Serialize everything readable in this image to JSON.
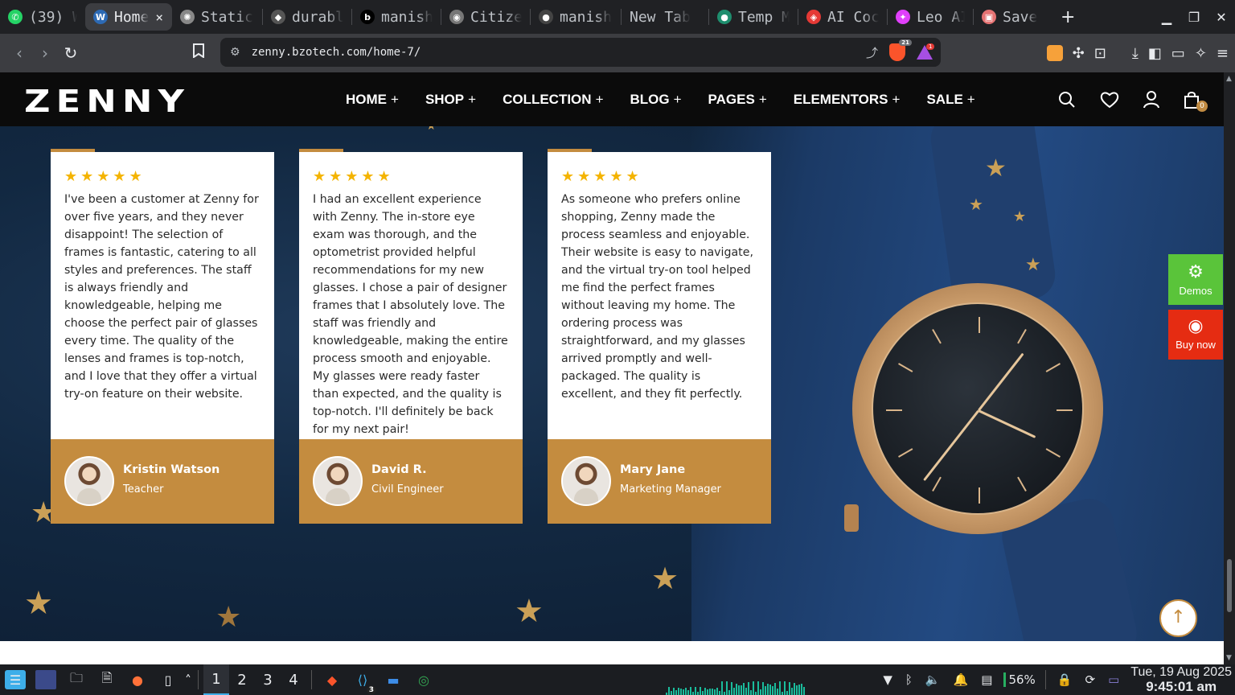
{
  "browser": {
    "tabs": [
      {
        "title": "(39) W",
        "color": "#25d366",
        "glyph": "✆"
      },
      {
        "title": "Home",
        "color": "#2d6ab4",
        "glyph": "W",
        "active": true,
        "close": "×"
      },
      {
        "title": "Static",
        "color": "#888888",
        "glyph": "✺"
      },
      {
        "title": "durabl",
        "color": "#555555",
        "glyph": "◆"
      },
      {
        "title": "manish",
        "color": "#000000",
        "glyph": "b"
      },
      {
        "title": "Citize",
        "color": "#777777",
        "glyph": "◉"
      },
      {
        "title": "manish",
        "color": "#444444",
        "glyph": "●"
      },
      {
        "title": "New Tab",
        "color": "",
        "glyph": ""
      },
      {
        "title": "Temp M",
        "color": "#1e8e6e",
        "glyph": "●"
      },
      {
        "title": "AI Coc",
        "color": "#e53935",
        "glyph": "◈"
      },
      {
        "title": "Leo AI",
        "color": "#e040fb",
        "glyph": "✦"
      },
      {
        "title": "Save",
        "color": "#e57373",
        "glyph": "▣"
      }
    ],
    "new_tab_label": "+",
    "url": "zenny.bzotech.com/home-7/",
    "brave_badge": "21",
    "rewards_badge": "1"
  },
  "site": {
    "logo": "ZENNY",
    "nav": [
      {
        "label": "HOME",
        "plus": "+"
      },
      {
        "label": "SHOP",
        "plus": "+"
      },
      {
        "label": "COLLECTION",
        "plus": "+"
      },
      {
        "label": "BLOG",
        "plus": "+"
      },
      {
        "label": "PAGES",
        "plus": "+"
      },
      {
        "label": "ELEMENTORS",
        "plus": "+"
      },
      {
        "label": "SALE",
        "plus": "+"
      }
    ],
    "cart_count": "0",
    "accent": "#c48c3f"
  },
  "testimonials": [
    {
      "stars": "★★★★★",
      "quote": "I've been a customer at Zenny for over five years, and they never disappoint! The selection of frames is fantastic, catering to all styles and preferences. The staff is always friendly and knowledgeable, helping me choose the perfect pair of glasses every time. The quality of the lenses and frames is top-notch, and I love that they offer a virtual try-on feature on their website.",
      "name": "Kristin Watson",
      "role": "Teacher"
    },
    {
      "stars": "★★★★★",
      "quote": "I had an excellent experience with Zenny. The in-store eye exam was thorough, and the optometrist provided helpful recommendations for my new glasses. I chose a pair of designer frames that I absolutely love. The staff was friendly and knowledgeable, making the entire process smooth and enjoyable. My glasses were ready faster than expected, and the quality is top-notch. I'll definitely be back for my next pair!",
      "name": "David R.",
      "role": "Civil Engineer"
    },
    {
      "stars": "★★★★★",
      "quote": "As someone who prefers online shopping, Zenny made the process seamless and enjoyable. Their website is easy to navigate, and the virtual try-on tool helped me find the perfect frames without leaving my home. The ordering process was straightforward, and my glasses arrived promptly and well-packaged. The quality is excellent, and they fit perfectly.",
      "name": "Mary Jane",
      "role": "Marketing Manager"
    }
  ],
  "side_buttons": {
    "demos": "Demos",
    "buy_now": "Buy now"
  },
  "taskbar": {
    "desktops": [
      "1",
      "2",
      "3",
      "4"
    ],
    "vscode_badge": "3",
    "battery": "56%",
    "date": "Tue, 19 Aug 2025",
    "time": "9:45:01 am"
  }
}
